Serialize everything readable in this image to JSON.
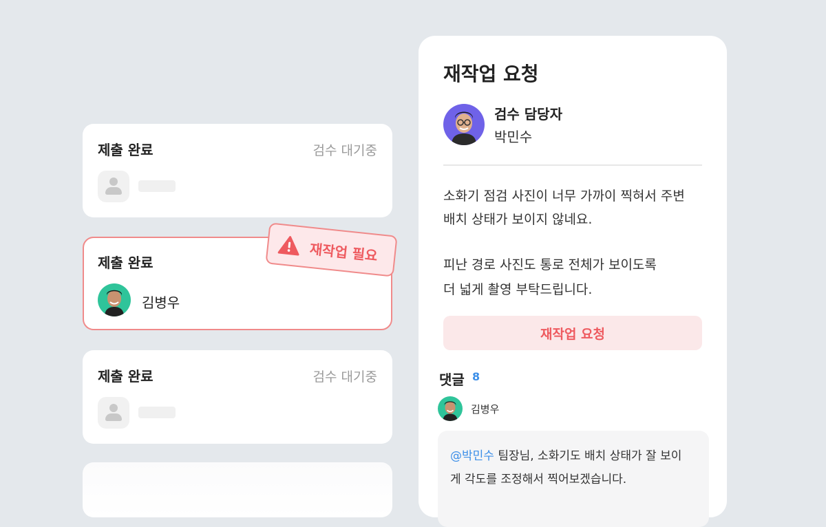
{
  "cards": [
    {
      "title": "제출 완료",
      "status": "검수 대기중"
    },
    {
      "title": "제출 완료",
      "user": "김병우",
      "badge": "재작업 필요"
    },
    {
      "title": "제출 완료",
      "status": "검수 대기중"
    }
  ],
  "panel": {
    "title": "재작업 요청",
    "reviewer_label": "검수 담당자",
    "reviewer_name": "박민수",
    "message_lines": [
      "소화기 점검 사진이 너무 가까이 찍혀서 주변",
      "배치 상태가 보이지 않네요.",
      "피난 경로 사진도 통로 전체가 보이도록",
      "더 넓게 촬영 부탁드립니다."
    ],
    "request_button": "재작업 요청",
    "comments_label": "댓글",
    "comments_count": "8",
    "comment": {
      "user": "김병우",
      "mention": "@박민수",
      "text_line1": " 팀장님, 소화기도 배치 상태가 잘 보이",
      "text_line2": "게 각도를 조정해서 찍어보겠습니다."
    }
  },
  "colors": {
    "background": "#e4e8ec",
    "alert": "#ee5a5f",
    "accent_blue": "#3d8fe8",
    "reviewer_avatar_bg": "#6f62e8",
    "user_avatar_bg": "#2fc49a"
  },
  "icons": [
    "user-placeholder-icon",
    "warning-icon"
  ]
}
